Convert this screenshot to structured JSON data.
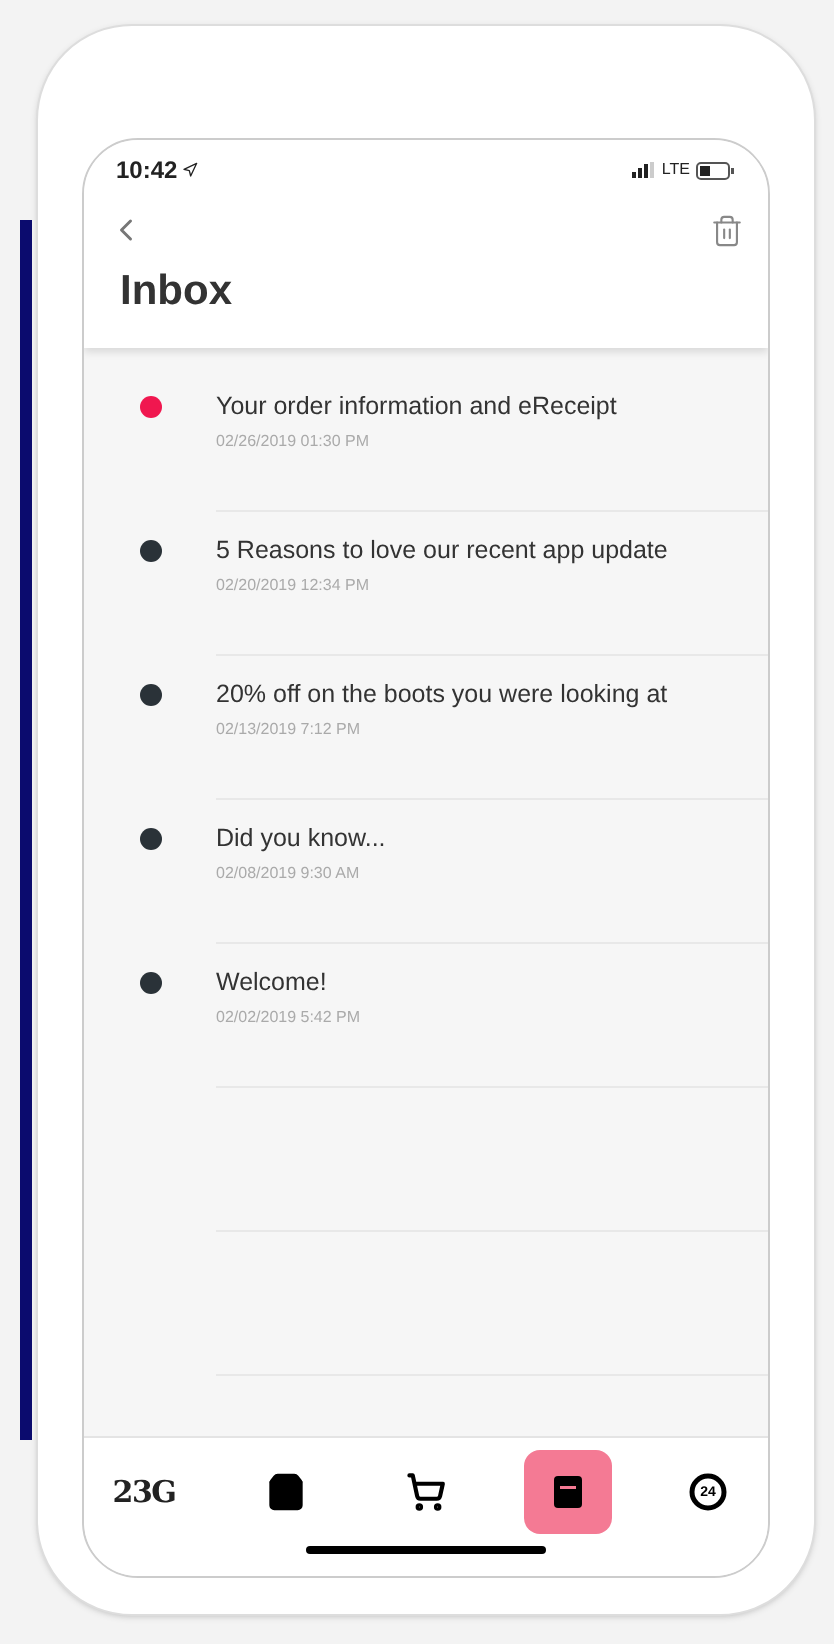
{
  "status_bar": {
    "time": "10:42",
    "network": "LTE"
  },
  "header": {
    "title": "Inbox"
  },
  "messages": [
    {
      "title": "Your order information and eReceipt",
      "date": "02/26/2019 01:30 PM",
      "unread": true
    },
    {
      "title": "5 Reasons to love our recent app update",
      "date": "02/20/2019 12:34 PM",
      "unread": false
    },
    {
      "title": "20% off on the boots you were looking at",
      "date": "02/13/2019 7:12 PM",
      "unread": false
    },
    {
      "title": "Did you know...",
      "date": "02/08/2019 9:30 AM",
      "unread": false
    },
    {
      "title": "Welcome!",
      "date": "02/02/2019 5:42 PM",
      "unread": false
    }
  ],
  "tab_bar": [
    {
      "kind": "logo",
      "label": "23G",
      "selected": false
    },
    {
      "kind": "bag",
      "selected": false
    },
    {
      "kind": "cart",
      "selected": false
    },
    {
      "kind": "inbox",
      "selected": true
    },
    {
      "kind": "account",
      "badge": "24",
      "selected": false
    }
  ]
}
